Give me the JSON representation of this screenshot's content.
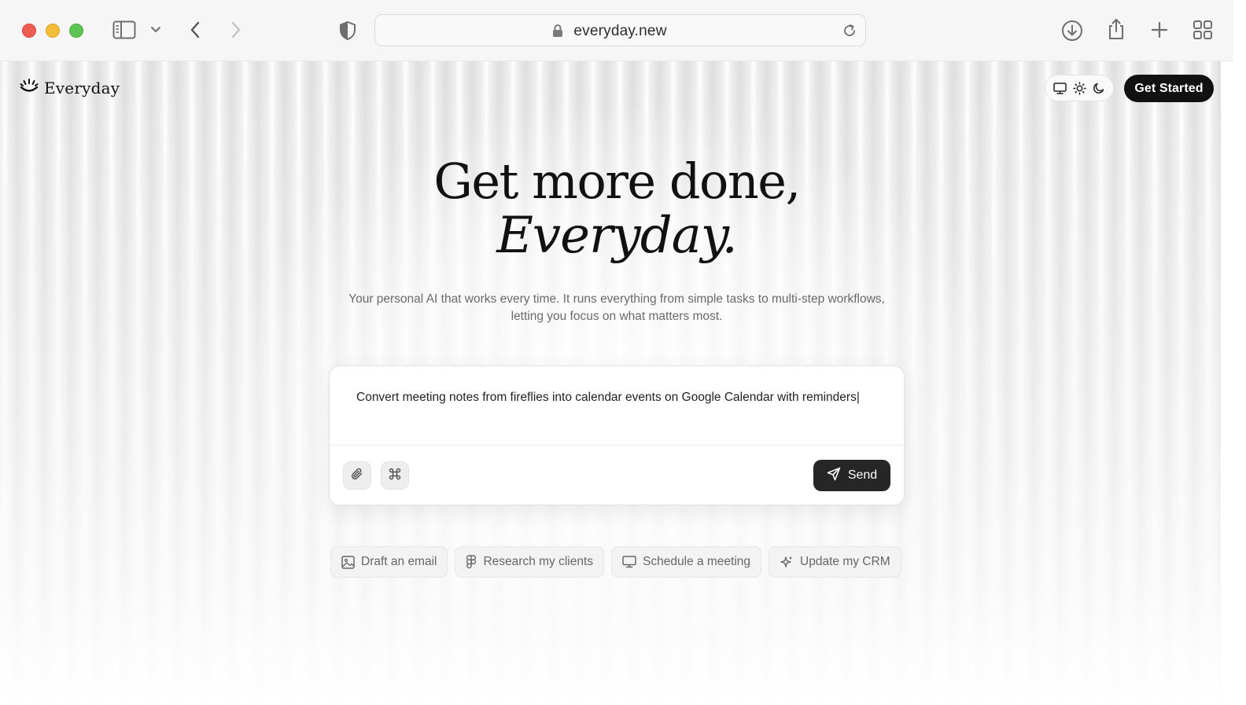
{
  "browser": {
    "url": "everyday.new",
    "icons": [
      "sidebar-icon",
      "chevron-down-icon",
      "back-icon",
      "forward-icon",
      "shield-icon",
      "lock-icon",
      "reload-icon",
      "download-icon",
      "share-icon",
      "plus-icon",
      "tabs-grid-icon"
    ]
  },
  "header": {
    "logo_text": "Everyday",
    "theme_icons": [
      "monitor-icon",
      "sun-icon",
      "moon-icon"
    ],
    "cta_label": "Get Started"
  },
  "hero": {
    "line1": "Get more done,",
    "line2": "Everyday.",
    "subtitle_line1": "Your personal AI that works every time. It runs everything from simple tasks to multi-step workflows,",
    "subtitle_line2": "letting you focus on what matters most."
  },
  "composer": {
    "input_value": "Convert meeting notes from fireflies into calendar events on Google Calendar with reminders|",
    "send_label": "Send"
  },
  "suggestions": [
    {
      "label": "Draft an email",
      "icon": "image-icon"
    },
    {
      "label": "Research my clients",
      "icon": "figma-icon"
    },
    {
      "label": "Schedule a meeting",
      "icon": "monitor-icon"
    },
    {
      "label": "Update my CRM",
      "icon": "sparkles-icon"
    }
  ],
  "colors": {
    "cta_background": "#111111",
    "send_background": "#262626",
    "traffic_red": "#ee5d54",
    "traffic_yellow": "#f4bd38",
    "traffic_green": "#5fc454"
  }
}
